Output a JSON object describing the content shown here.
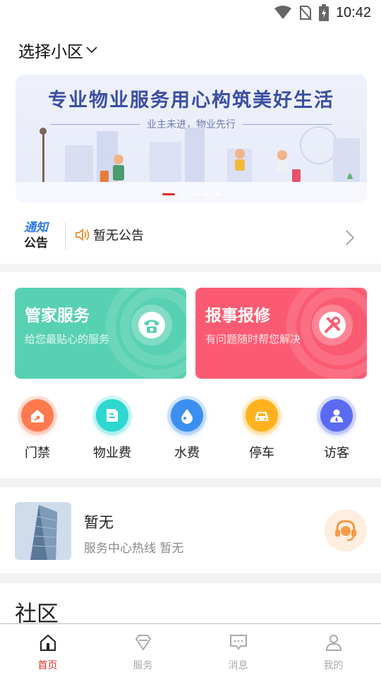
{
  "status_bar": {
    "time": "10:42"
  },
  "header": {
    "community_label": "选择小区"
  },
  "banner": {
    "headline": "专业物业服务用心构筑美好生活",
    "subline": "业主未进，物业先行",
    "slide_count": 5,
    "active_slide": 1
  },
  "notice": {
    "tag_line1": "通知",
    "tag_line2": "公告",
    "text": "暂无公告"
  },
  "cards": {
    "butler": {
      "title": "管家服务",
      "subtitle": "给您最贴心的服务",
      "color": "#58d1b2"
    },
    "repair": {
      "title": "报事报修",
      "subtitle": "有问题随时帮您解决",
      "color": "#fb5b72"
    }
  },
  "quick_actions": [
    {
      "label": "门禁",
      "icon": "door-access-icon",
      "color": "#ff7a4f"
    },
    {
      "label": "物业费",
      "icon": "property-fee-icon",
      "color": "#2fd7d0"
    },
    {
      "label": "水费",
      "icon": "water-drop-icon",
      "color": "#3b8ff0"
    },
    {
      "label": "停车",
      "icon": "car-icon",
      "color": "#ffb21e"
    },
    {
      "label": "访客",
      "icon": "visitor-icon",
      "color": "#5a6bf2"
    }
  ],
  "service_center": {
    "name": "暂无",
    "hotline": "服务中心热线 暂无"
  },
  "community": {
    "heading": "社区"
  },
  "tabbar": [
    {
      "label": "首页",
      "icon": "home-icon",
      "active": true
    },
    {
      "label": "服务",
      "icon": "gem-icon",
      "active": false
    },
    {
      "label": "消息",
      "icon": "message-icon",
      "active": false
    },
    {
      "label": "我的",
      "icon": "profile-icon",
      "active": false
    }
  ]
}
